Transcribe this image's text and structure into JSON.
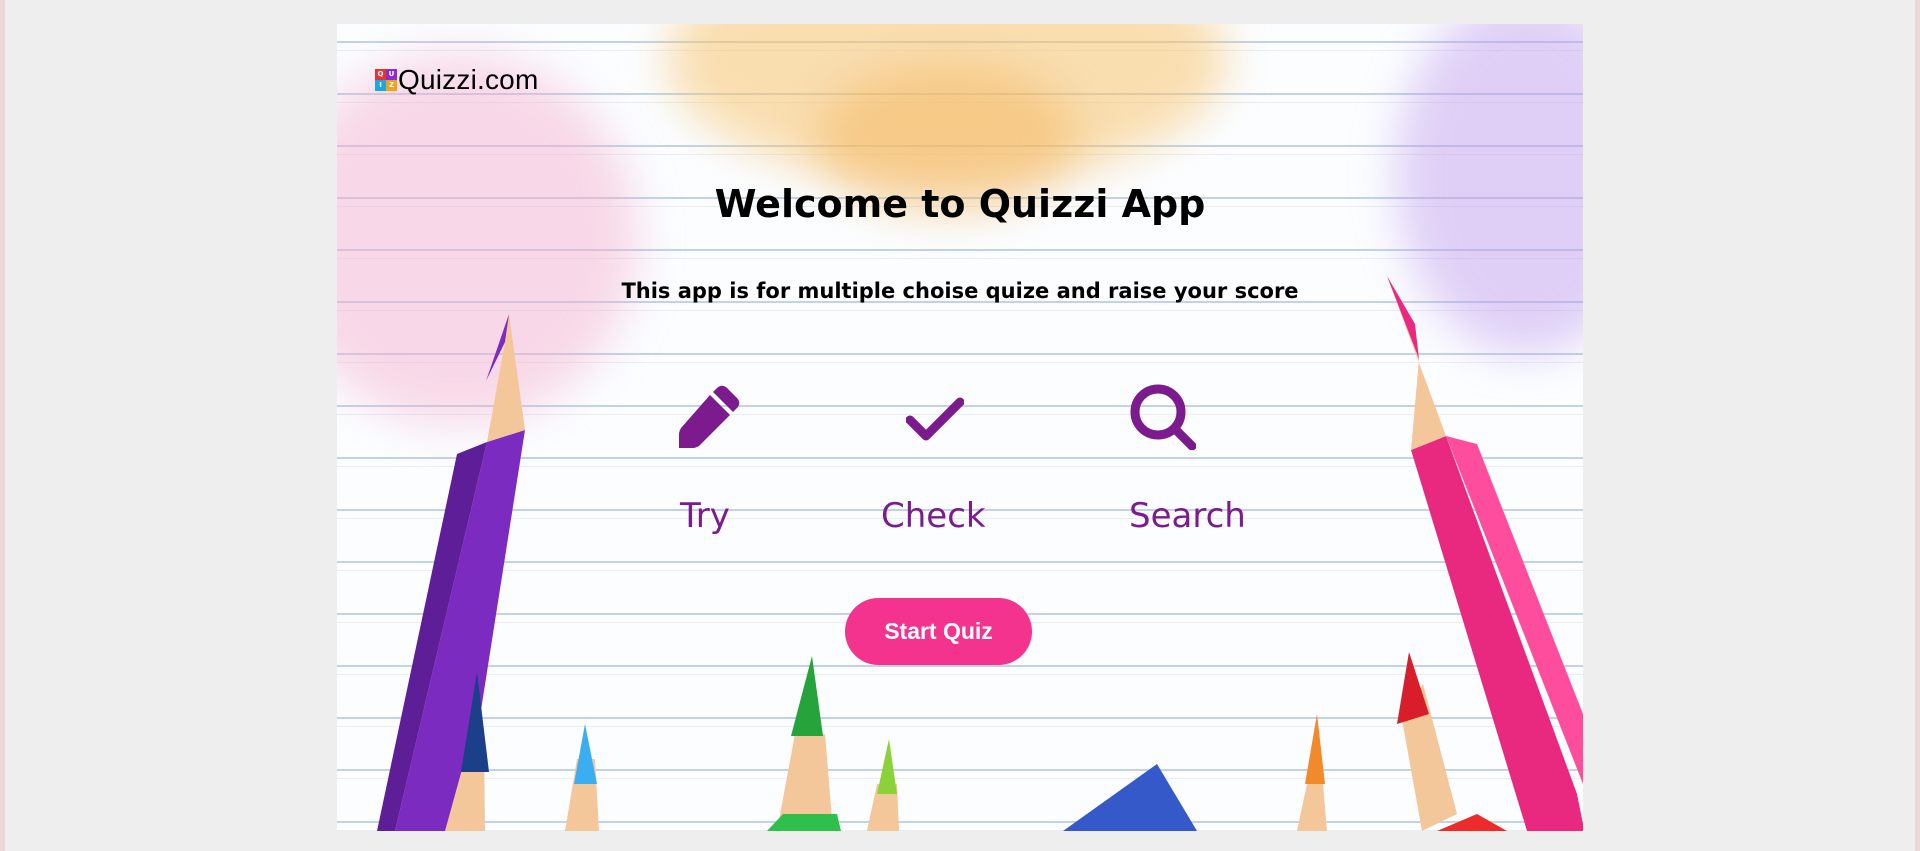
{
  "logo": {
    "letters": [
      "Q",
      "U",
      "I",
      "Z"
    ],
    "colors": [
      "#e8322e",
      "#8b2bd0",
      "#1aa6e8",
      "#f0a21a"
    ],
    "text": "Quizzi.com"
  },
  "hero": {
    "title": "Welcome to Quizzi App",
    "subtitle": "This app is for multiple choise quize and raise your score"
  },
  "features": [
    {
      "icon": "pencil-icon",
      "label": "Try"
    },
    {
      "icon": "checkmark-icon",
      "label": "Check"
    },
    {
      "icon": "search-icon",
      "label": "Search"
    }
  ],
  "actions": {
    "start_label": "Start Quiz"
  },
  "colors": {
    "accent": "#7c1b8e",
    "button": "#f4338f",
    "page_background": "#efeeee"
  }
}
